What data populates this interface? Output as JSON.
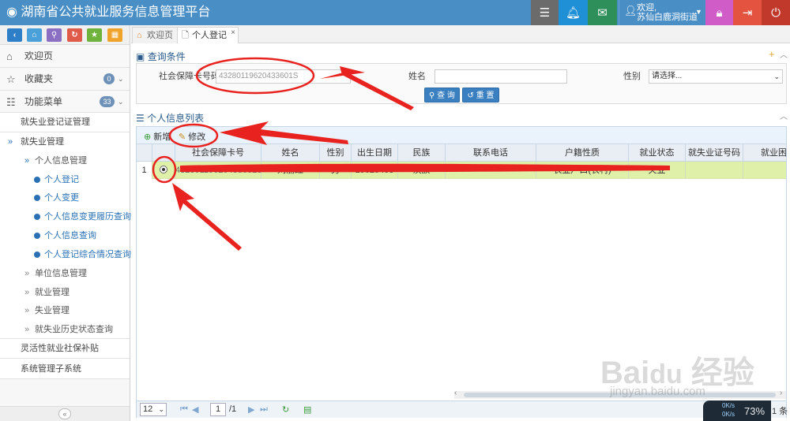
{
  "app": {
    "title": "湖南省公共就业服务信息管理平台"
  },
  "header": {
    "user_greeting": "欢迎,",
    "user_name": "苏仙白鹿洞街道",
    "colors": {
      "bar": "#4a8ec6",
      "bell": "#1f8fd6",
      "mail": "#2f8f5a",
      "lock": "#d05cc8",
      "logout": "#e4533f",
      "power": "#c0392b"
    }
  },
  "sidebar": {
    "welcome": "欢迎页",
    "favorites": {
      "label": "收藏夹",
      "count": "0"
    },
    "menu": {
      "label": "功能菜单",
      "count": "33"
    },
    "items": {
      "reg_cert": "就失业登记证管理",
      "employment": "就失业管理",
      "personal_info": "个人信息管理",
      "personal_reg": "个人登记",
      "personal_change": "个人变更",
      "change_history": "个人信息变更履历查询",
      "info_query": "个人信息查询",
      "reg_summary": "个人登记综合情况查询",
      "unit_info": "单位信息管理",
      "job_mgmt": "就业管理",
      "unemp_mgmt": "失业管理",
      "history_query": "就失业历史状态查询",
      "flexible": "灵活性就业社保补贴",
      "sysmgmt": "系统管理子系统"
    }
  },
  "tabs": {
    "welcome": "欢迎页",
    "active": "个人登记"
  },
  "query": {
    "title": "查询条件",
    "ssn_label": "社会保障卡号码",
    "ssn_value": "43280119620433601S",
    "name_label": "姓名",
    "name_value": "",
    "gender_label": "性别",
    "gender_value": "请选择...",
    "search_btn": "查 询",
    "reset_btn": "重 置"
  },
  "list": {
    "title": "个人信息列表",
    "add_btn": "新增",
    "edit_btn": "修改",
    "columns": [
      "社会保障卡号",
      "姓名",
      "性别",
      "出生日期",
      "民族",
      "联系电话",
      "户籍性质",
      "就业状态",
      "就失业证号码",
      "就业困难"
    ],
    "row": {
      "index": "1",
      "ssn": "43280119620433601S",
      "name": "刘丽红",
      "gender": "男",
      "birth": "19620403",
      "nation": "汉族",
      "phone": "",
      "hukou": "农业户口(农村)",
      "status": "失业",
      "cert": "",
      "difficulty": ""
    }
  },
  "pager": {
    "page_size": "12",
    "page": "1",
    "total_pages": "/1",
    "records": "1 条"
  },
  "widget": {
    "percent": "73%",
    "up": "0K/s",
    "down": "0K/s"
  },
  "watermark": {
    "site": "jingyan.baidu.com"
  }
}
